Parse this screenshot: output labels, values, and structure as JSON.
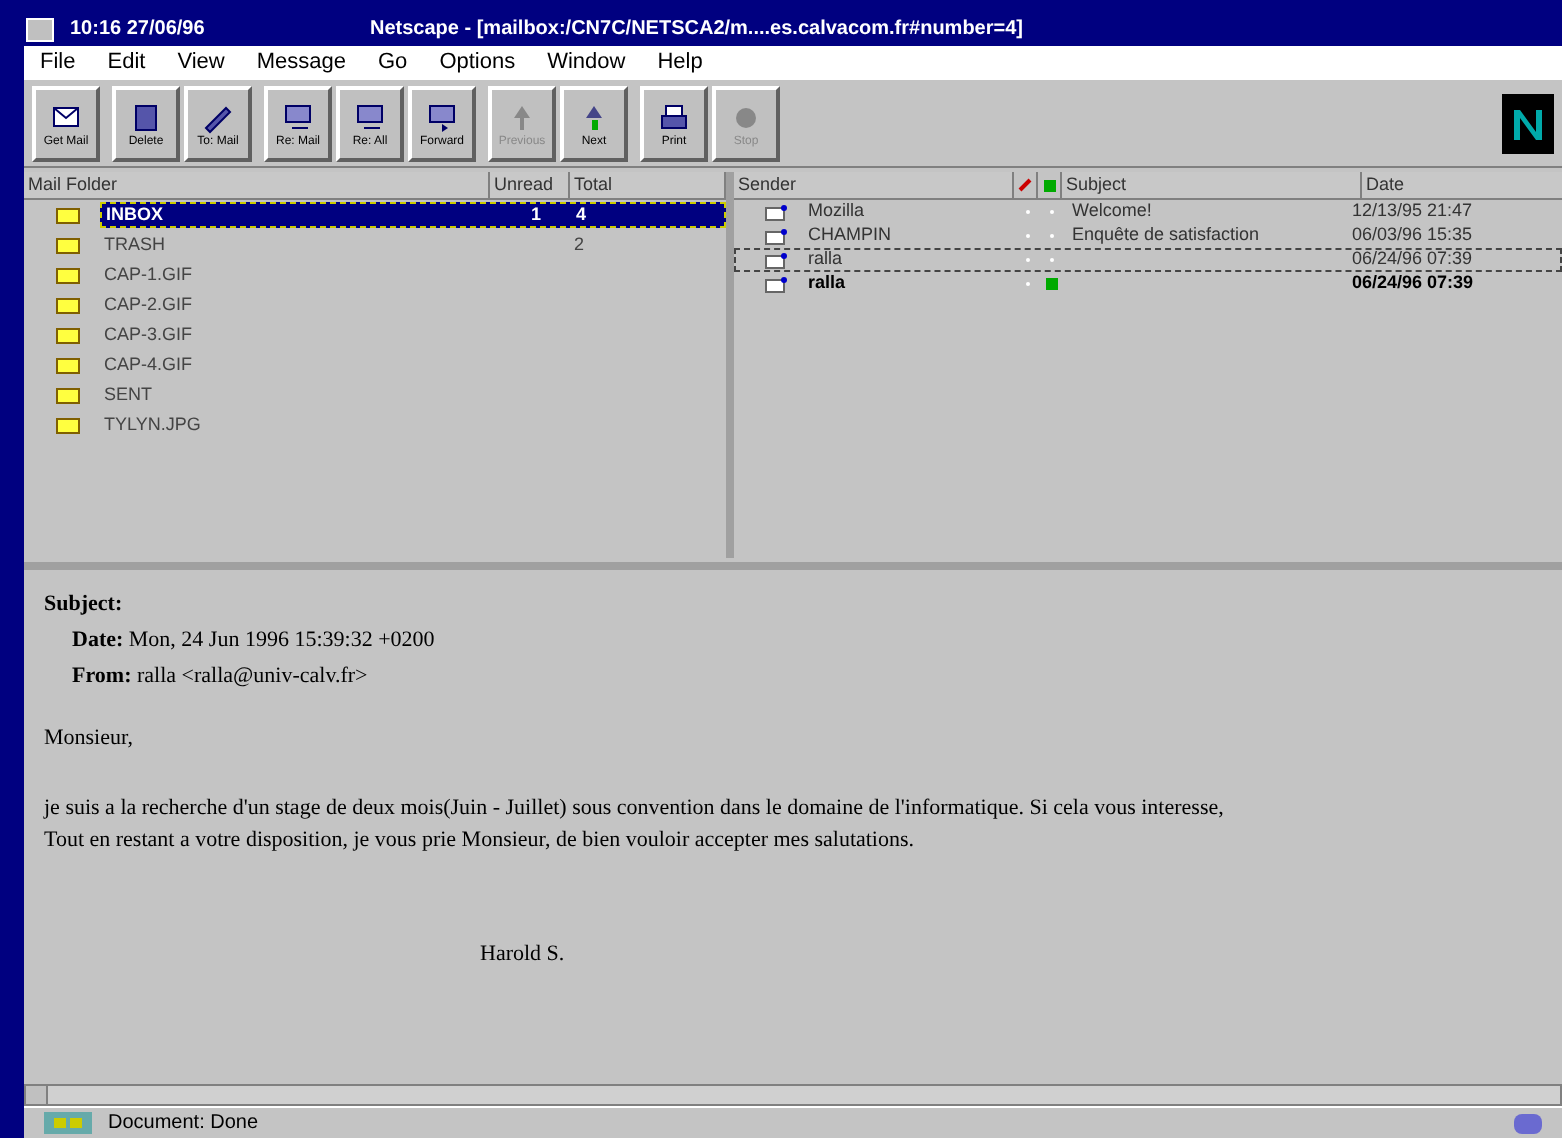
{
  "window": {
    "clock": "10:16  27/06/96",
    "title": "Netscape - [mailbox:/CN7C/NETSCA2/m....es.calvacom.fr#number=4]"
  },
  "menu": [
    "File",
    "Edit",
    "View",
    "Message",
    "Go",
    "Options",
    "Window",
    "Help"
  ],
  "toolbar": [
    {
      "label": "Get Mail",
      "kind": "get",
      "disabled": false
    },
    {
      "label": "Delete",
      "kind": "delete",
      "disabled": false
    },
    {
      "label": "To: Mail",
      "kind": "compose",
      "disabled": false
    },
    {
      "label": "Re: Mail",
      "kind": "reply",
      "disabled": false
    },
    {
      "label": "Re: All",
      "kind": "reply",
      "disabled": false
    },
    {
      "label": "Forward",
      "kind": "forward",
      "disabled": false
    },
    {
      "label": "Previous",
      "kind": "previous",
      "disabled": true
    },
    {
      "label": "Next",
      "kind": "next",
      "disabled": false
    },
    {
      "label": "Print",
      "kind": "print",
      "disabled": false
    },
    {
      "label": "Stop",
      "kind": "stop",
      "disabled": true
    }
  ],
  "folders": {
    "columns": [
      "Mail Folder",
      "Unread",
      "Total"
    ],
    "rows": [
      {
        "name": "INBOX",
        "unread": "1",
        "total": "4",
        "selected": true
      },
      {
        "name": "TRASH",
        "total": "2",
        "selected": false
      },
      {
        "name": "CAP-1.GIF",
        "selected": false
      },
      {
        "name": "CAP-2.GIF",
        "selected": false
      },
      {
        "name": "CAP-3.GIF",
        "selected": false
      },
      {
        "name": "CAP-4.GIF",
        "selected": false
      },
      {
        "name": "SENT",
        "selected": false
      },
      {
        "name": "TYLYN.JPG",
        "selected": false
      }
    ]
  },
  "messages": {
    "columns": [
      "Sender",
      "Subject",
      "Date"
    ],
    "rows": [
      {
        "sender": "Mozilla",
        "subject": "Welcome!",
        "date": "12/13/95 21:47",
        "unread": false,
        "flagged": false,
        "focused": false
      },
      {
        "sender": "CHAMPIN",
        "subject": "Enquête de satisfaction",
        "date": "06/03/96 15:35",
        "unread": false,
        "flagged": false,
        "focused": false
      },
      {
        "sender": "ralla",
        "date": "06/24/96 07:39",
        "unread": false,
        "flagged": false,
        "focused": true
      },
      {
        "sender": "ralla",
        "date": "06/24/96 07:39",
        "unread": true,
        "flagged": true,
        "focused": false
      }
    ]
  },
  "message": {
    "headers": [
      {
        "label": "Subject:"
      },
      {
        "label": "Date:",
        "value": "Mon, 24 Jun 1996 15:39:32 +0200"
      },
      {
        "label": "From:",
        "value": "ralla <ralla@univ-calv.fr>"
      }
    ],
    "body": [
      "Monsieur,",
      "je suis a la recherche d'un stage de deux mois(Juin - Juillet)  sous convention dans le domaine de l'informatique. Si cela vous interesse,",
      "Tout en restant a votre disposition, je vous prie Monsieur, de bien vouloir accepter mes salutations."
    ],
    "signature": "Harold S."
  },
  "status_bar": {
    "text": "Document: Done"
  }
}
